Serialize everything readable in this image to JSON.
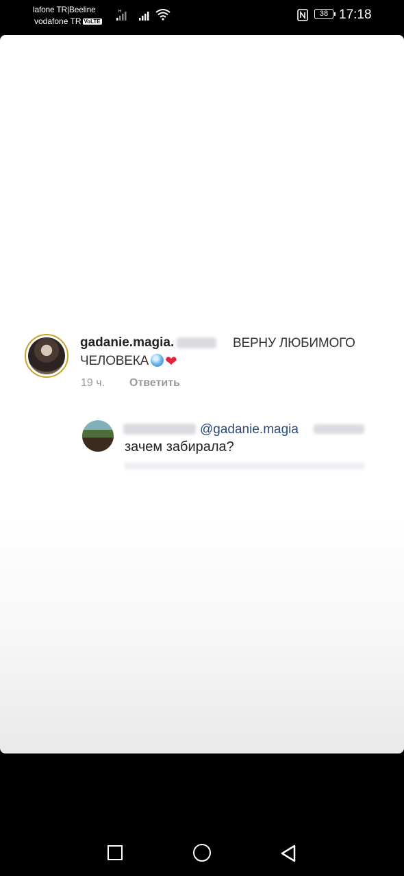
{
  "status_bar": {
    "carrier_line1": "lafone TR|Beeline",
    "carrier_line2": "vodafone TR",
    "volte_badge": "VoLTE",
    "battery": "38",
    "time": "17:18"
  },
  "comments": {
    "parent": {
      "username": "gadanie.magia.",
      "text_line1": "ВЕРНУ ЛЮБИМОГО",
      "text_line2": "ЧЕЛОВЕКА",
      "time": "19 ч.",
      "reply_label": "Ответить"
    },
    "reply": {
      "mention": "@gadanie.magia",
      "text": "зачем забирала?"
    }
  },
  "colors": {
    "mention": "#2b4a7a",
    "heart": "#e0243a",
    "story_ring": "#c9a227"
  },
  "icons": {
    "nav_recent": "square-icon",
    "nav_home": "circle-icon",
    "nav_back": "triangle-back-icon"
  }
}
